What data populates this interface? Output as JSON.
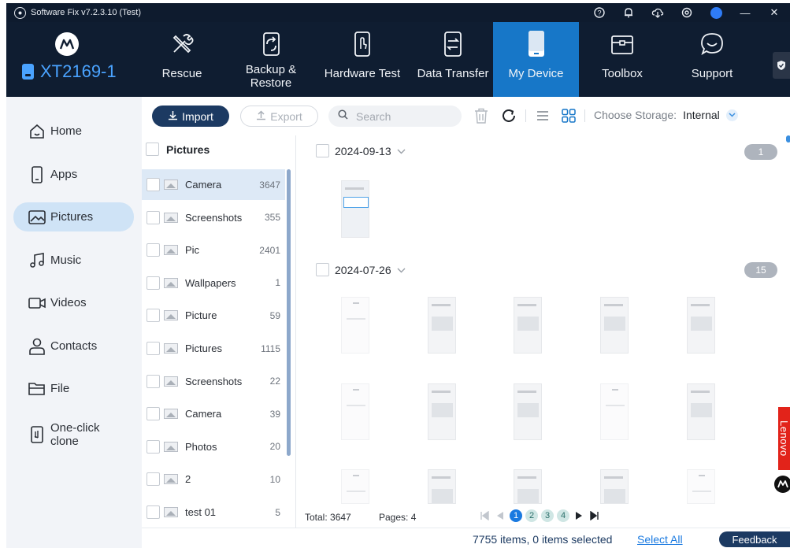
{
  "window": {
    "title": "Software Fix v7.2.3.10 (Test)",
    "icons": [
      "help-icon",
      "bell-icon",
      "cloud-download-icon",
      "settings-icon",
      "user-avatar-icon",
      "minimize-icon",
      "close-icon"
    ],
    "minimize_glyph": "—",
    "close_glyph": "✕"
  },
  "brand": {
    "device_name": "XT2169-1",
    "accent": "#4aa3ff"
  },
  "nav": [
    {
      "label": "Rescue",
      "icon": "wrench-screwdriver-icon"
    },
    {
      "label": "Backup &",
      "label2": "Restore",
      "icon": "backup-icon"
    },
    {
      "label": "Hardware Test",
      "icon": "phone-touch-icon"
    },
    {
      "label": "Data Transfer",
      "icon": "transfer-icon"
    },
    {
      "label": "My Device",
      "icon": "my-device-icon",
      "active": true
    },
    {
      "label": "Toolbox",
      "icon": "toolbox-icon"
    },
    {
      "label": "Support",
      "icon": "chat-bubble-icon"
    }
  ],
  "sidebar": {
    "items": [
      {
        "label": "Home",
        "icon": "home-icon"
      },
      {
        "label": "Apps",
        "icon": "phone-icon"
      },
      {
        "label": "Pictures",
        "icon": "picture-icon",
        "active": true
      },
      {
        "label": "Music",
        "icon": "music-icon"
      },
      {
        "label": "Videos",
        "icon": "video-icon"
      },
      {
        "label": "Contacts",
        "icon": "contact-icon"
      },
      {
        "label": "File",
        "icon": "folder-icon"
      },
      {
        "label": "One-click",
        "label2": "clone",
        "icon": "clone-icon"
      }
    ]
  },
  "toolbar": {
    "import_label": "Import",
    "export_label": "Export",
    "search_placeholder": "Search",
    "storage_label": "Choose Storage:",
    "storage_value": "Internal",
    "icons": [
      "delete-icon",
      "refresh-icon",
      "list-view-icon",
      "grid-view-icon"
    ]
  },
  "albums": {
    "header": "Pictures",
    "items": [
      {
        "name": "Camera",
        "count": "3647",
        "active": true
      },
      {
        "name": "Screenshots",
        "count": "355"
      },
      {
        "name": "Pic",
        "count": "2401"
      },
      {
        "name": "Wallpapers",
        "count": "1"
      },
      {
        "name": "Picture",
        "count": "59"
      },
      {
        "name": "Pictures",
        "count": "1115"
      },
      {
        "name": "Screenshots",
        "count": "22"
      },
      {
        "name": "Camera",
        "count": "39"
      },
      {
        "name": "Photos",
        "count": "20"
      },
      {
        "name": "2",
        "count": "10"
      },
      {
        "name": "test 01",
        "count": "5"
      }
    ]
  },
  "groups": [
    {
      "date": "2024-09-13",
      "count": "1"
    },
    {
      "date": "2024-07-26",
      "count": "15"
    }
  ],
  "footer": {
    "total": "Total: 3647",
    "pages": "Pages: 4",
    "page_numbers": [
      "1",
      "2",
      "3",
      "4"
    ],
    "current_page": "1",
    "status": "7755 items, 0 items selected",
    "select_all": "Select All",
    "feedback": "Feedback"
  },
  "side_widgets": {
    "lenovo": "Lenovo",
    "lenovo_color": "#e2231a"
  }
}
